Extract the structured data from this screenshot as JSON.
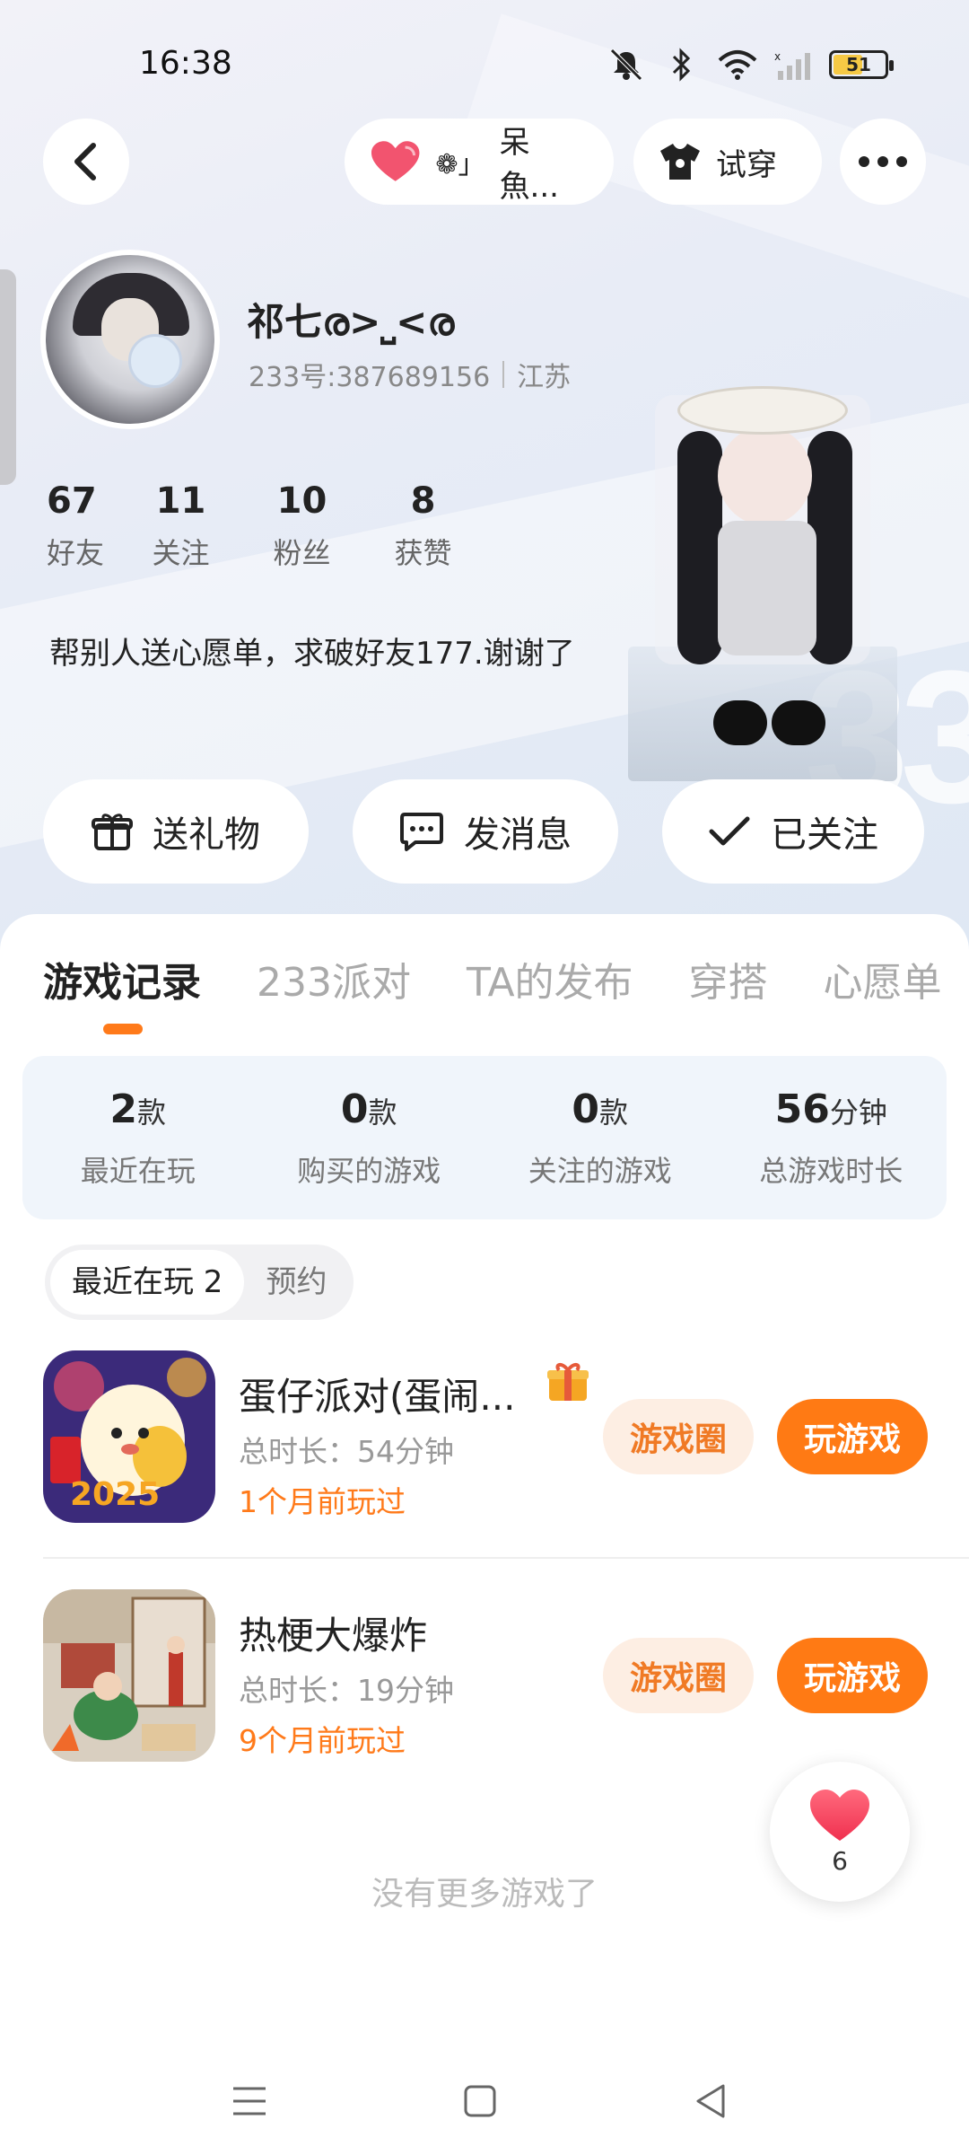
{
  "status_bar": {
    "time": "16:38",
    "battery": "51"
  },
  "header": {
    "pet_name": "呆魚...",
    "try_on_label": "试穿"
  },
  "profile": {
    "username": "祁七ര>⎵<ര",
    "id_text": "233号:387689156",
    "location": "江苏",
    "stats": [
      {
        "value": "67",
        "label": "好友"
      },
      {
        "value": "11",
        "label": "关注"
      },
      {
        "value": "10",
        "label": "粉丝"
      },
      {
        "value": "8",
        "label": "获赞"
      }
    ],
    "bio": "帮别人送心愿单，求破好友177.谢谢了"
  },
  "actions": {
    "gift": "送礼物",
    "message": "发消息",
    "followed": "已关注"
  },
  "tabs": [
    "游戏记录",
    "233派对",
    "TA的发布",
    "穿搭",
    "心愿单"
  ],
  "summary": [
    {
      "value": "2",
      "unit": "款",
      "label": "最近在玩"
    },
    {
      "value": "0",
      "unit": "款",
      "label": "购买的游戏"
    },
    {
      "value": "0",
      "unit": "款",
      "label": "关注的游戏"
    },
    {
      "value": "56",
      "unit": "分钟",
      "label": "总游戏时长"
    }
  ],
  "subtabs": {
    "recent": "最近在玩 2",
    "reserve": "预约"
  },
  "games": [
    {
      "title": "蛋仔派对(蛋闹...",
      "duration": "总时长：54分钟",
      "last_played": "1个月前玩过",
      "circle_btn": "游戏圈",
      "play_btn": "玩游戏"
    },
    {
      "title": "热梗大爆炸",
      "duration": "总时长：19分钟",
      "last_played": "9个月前玩过",
      "circle_btn": "游戏圈",
      "play_btn": "玩游戏"
    }
  ],
  "footer_note": "没有更多游戏了",
  "like_count": "6",
  "icons": {
    "back": "chevron-left-icon",
    "heart": "heart-icon",
    "shirt": "shirt-icon",
    "more": "more-icon",
    "gift": "gift-icon",
    "message": "chat-icon",
    "check": "check-icon"
  },
  "colors": {
    "accent": "#ff7a14",
    "accent_light": "#fdeee3",
    "heart": "#f2546f"
  }
}
